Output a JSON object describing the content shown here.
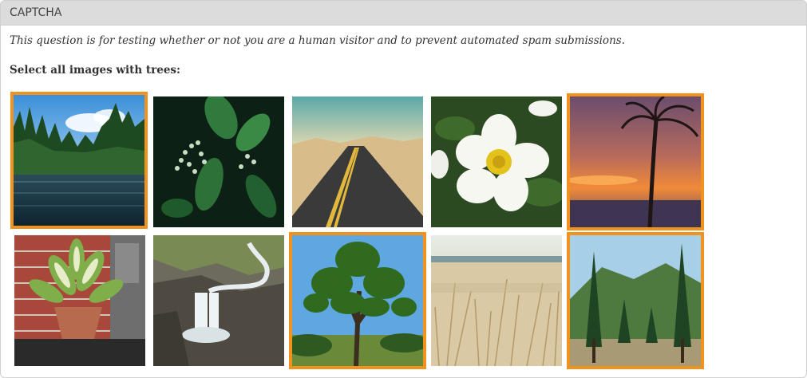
{
  "header": {
    "title": "CAPTCHA"
  },
  "description": "This question is for testing whether or not you are a human visitor and to prevent automated spam submissions.",
  "prompt": "Select all images with trees:",
  "grid": {
    "images": [
      {
        "name": "lake-forest-image",
        "selected": true
      },
      {
        "name": "green-leaves-image",
        "selected": false
      },
      {
        "name": "desert-road-image",
        "selected": false
      },
      {
        "name": "white-flower-image",
        "selected": false
      },
      {
        "name": "palm-tree-sunset-image",
        "selected": true
      },
      {
        "name": "potted-plant-image",
        "selected": false
      },
      {
        "name": "waterfall-image",
        "selected": false
      },
      {
        "name": "large-tree-image",
        "selected": true
      },
      {
        "name": "dry-grass-image",
        "selected": false
      },
      {
        "name": "pine-trees-mountain-image",
        "selected": true
      }
    ]
  },
  "colors": {
    "selection": "#f0921e",
    "header_bg": "#dcdcdc"
  }
}
